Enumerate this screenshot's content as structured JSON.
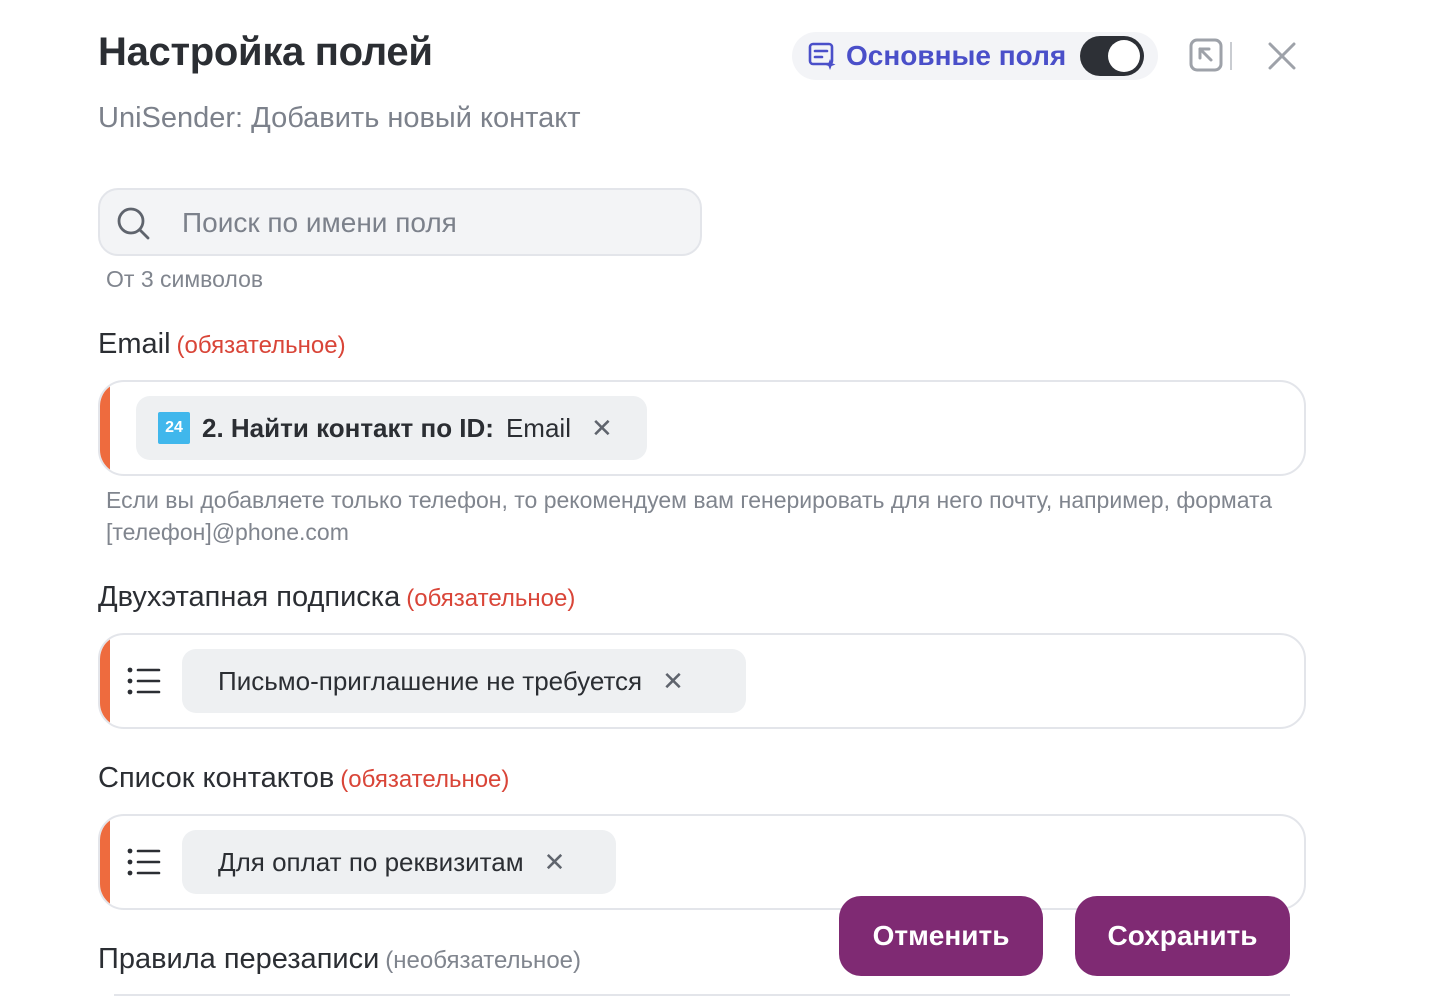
{
  "header": {
    "title": "Настройка полей",
    "subtitle": "UniSender: Добавить новый контакт",
    "main_fields_label": "Основные поля",
    "main_fields_enabled": true
  },
  "search": {
    "placeholder": "Поиск по имени поля",
    "hint": "От 3 символов"
  },
  "fields": [
    {
      "label": "Email",
      "requirement": "(обязательное)",
      "chip_badge": "24",
      "chip_source": "2. Найти контакт по ID:",
      "chip_value": "Email",
      "remove_glyph": "✕",
      "hint": "Если вы добавляете только телефон, то рекомендуем вам генерировать для него почту, например, формата [телефон]@phone.com"
    },
    {
      "label": "Двухэтапная подписка",
      "requirement": "(обязательное)",
      "chip_value": "Письмо-приглашение не требуется",
      "remove_glyph": "✕"
    },
    {
      "label": "Список контактов",
      "requirement": "(обязательное)",
      "chip_value": "Для оплат по реквизитам",
      "remove_glyph": "✕"
    },
    {
      "label": "Правила перезаписи",
      "requirement": "(необязательное)"
    }
  ],
  "actions": {
    "cancel_label": "Отменить",
    "save_label": "Сохранить"
  },
  "colors": {
    "accent_required": "#ee6b3e",
    "primary_button": "#7f2a73",
    "main_fields_text": "#4a4fc9",
    "required_text": "#d94538",
    "badge_24": "#40b7ec"
  }
}
